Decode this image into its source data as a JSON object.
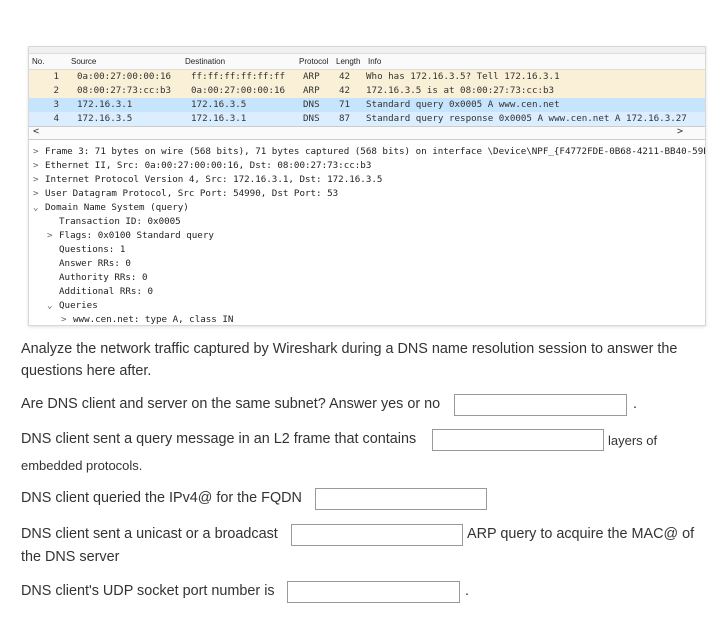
{
  "packet_list": {
    "headers": {
      "no": "No.",
      "source": "Source",
      "destination": "Destination",
      "protocol": "Protocol",
      "length": "Length",
      "info": "Info"
    },
    "rows": [
      {
        "no": "1",
        "source": "0a:00:27:00:00:16",
        "destination": "ff:ff:ff:ff:ff:ff",
        "protocol": "ARP",
        "length": "42",
        "info": "Who has 172.16.3.5? Tell 172.16.3.1",
        "bg": "#faf0d7"
      },
      {
        "no": "2",
        "source": "08:00:27:73:cc:b3",
        "destination": "0a:00:27:00:00:16",
        "protocol": "ARP",
        "length": "42",
        "info": "172.16.3.5 is at 08:00:27:73:cc:b3",
        "bg": "#faf0d7"
      },
      {
        "no": "3",
        "source": "172.16.3.1",
        "destination": "172.16.3.5",
        "protocol": "DNS",
        "length": "71",
        "info": "Standard query 0x0005 A www.cen.net",
        "bg": "#c6e4fb"
      },
      {
        "no": "4",
        "source": "172.16.3.5",
        "destination": "172.16.3.1",
        "protocol": "DNS",
        "length": "87",
        "info": "Standard query response 0x0005 A www.cen.net A 172.16.3.27",
        "bg": "#daeeff"
      }
    ],
    "scroll_left": "<",
    "scroll_right": ">"
  },
  "packet_details": [
    {
      "arrow": ">",
      "indent": 0,
      "text": "Frame 3: 71 bytes on wire (568 bits), 71 bytes captured (568 bits) on interface \\Device\\NPF_{F4772FDE-0B68-4211-BB40-59B6"
    },
    {
      "arrow": ">",
      "indent": 0,
      "text": "Ethernet II, Src: 0a:00:27:00:00:16, Dst: 08:00:27:73:cc:b3"
    },
    {
      "arrow": ">",
      "indent": 0,
      "text": "Internet Protocol Version 4, Src: 172.16.3.1, Dst: 172.16.3.5"
    },
    {
      "arrow": ">",
      "indent": 0,
      "text": "User Datagram Protocol, Src Port: 54990, Dst Port: 53"
    },
    {
      "arrow": "⌄",
      "indent": 0,
      "text": "Domain Name System (query)"
    },
    {
      "arrow": "",
      "indent": 1,
      "text": "Transaction ID: 0x0005"
    },
    {
      "arrow": ">",
      "indent": 1,
      "text": "Flags: 0x0100 Standard query"
    },
    {
      "arrow": "",
      "indent": 1,
      "text": "Questions: 1"
    },
    {
      "arrow": "",
      "indent": 1,
      "text": "Answer RRs: 0"
    },
    {
      "arrow": "",
      "indent": 1,
      "text": "Authority RRs: 0"
    },
    {
      "arrow": "",
      "indent": 1,
      "text": "Additional RRs: 0"
    },
    {
      "arrow": "⌄",
      "indent": 1,
      "text": "Queries"
    },
    {
      "arrow": ">",
      "indent": 2,
      "text": "www.cen.net: type A, class IN"
    }
  ],
  "questions": {
    "intro": "Analyze the network traffic captured by Wireshark during a DNS name resolution session to answer the questions here after.",
    "q1": "Are DNS client and server on the same subnet? Answer yes or no",
    "q1_end": ".",
    "q2": "DNS client sent a query message in an L2 frame that contains",
    "q2_after": "layers of",
    "q2_cont": "embedded protocols.",
    "q3": "DNS client queried the IPv4@ for the FQDN",
    "q4": "DNS client sent a unicast or a broadcast",
    "q4_after": "ARP query to acquire the MAC@ of",
    "q4_cont": "the DNS server",
    "q5": "DNS client's UDP socket port number is",
    "q5_end": "."
  }
}
